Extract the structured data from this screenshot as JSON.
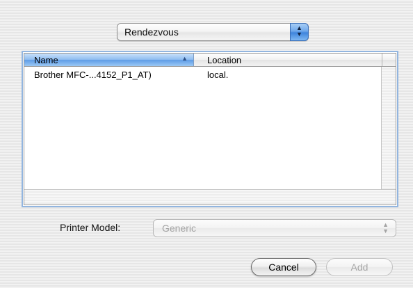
{
  "popup": {
    "selected": "Rendezvous",
    "stepper_glyph": "▲▼"
  },
  "list": {
    "columns": {
      "name": "Name",
      "location": "Location",
      "sort_indicator": "▲"
    },
    "rows": [
      {
        "name": "Brother MFC-...4152_P1_AT)",
        "location": "local."
      }
    ]
  },
  "printer_model": {
    "label": "Printer Model:",
    "value": "Generic",
    "enabled": false
  },
  "buttons": {
    "cancel": "Cancel",
    "add": "Add",
    "add_enabled": false
  },
  "colors": {
    "accent_blue": "#5f9ce6",
    "focus_ring": "#92b5df",
    "disabled_text": "#a2a2a2"
  }
}
